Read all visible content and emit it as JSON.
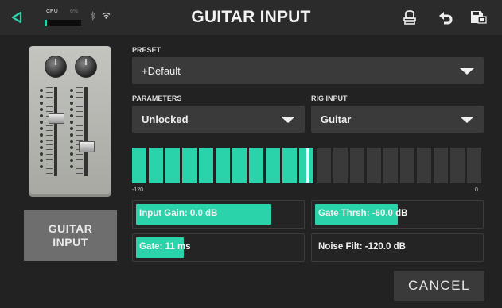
{
  "topbar": {
    "title": "GUITAR INPUT",
    "cpu_label": "CPU",
    "cpu_percent": "6%",
    "cpu_level": 0.06,
    "icons": [
      "back-arrow-icon",
      "bluetooth-icon",
      "wifi-icon",
      "tuner-icon",
      "undo-icon",
      "save-icon"
    ]
  },
  "sidebar": {
    "button_label": "GUITAR INPUT"
  },
  "preset": {
    "label": "PRESET",
    "value": "+Default"
  },
  "parameters": {
    "label": "PARAMETERS",
    "value": "Unlocked"
  },
  "rig_input": {
    "label": "RIG INPUT",
    "value": "Guitar"
  },
  "meter": {
    "min_label": "-120",
    "max_label": "0",
    "segments": 21,
    "lit_segments": 11,
    "accent": "#2ad3a9"
  },
  "params": {
    "input_gain": {
      "text": "Input Gain: 0.0 dB",
      "level": 0.82
    },
    "gate_threshold": {
      "text": "Gate Thrsh: -60.0 dB",
      "level": 0.5
    },
    "gate": {
      "text": "Gate: 11 ms",
      "level": 0.29
    },
    "noise_filter": {
      "text": "Noise Filt: -120.0 dB",
      "level": 0.0
    }
  },
  "footer": {
    "cancel_label": "CANCEL"
  }
}
